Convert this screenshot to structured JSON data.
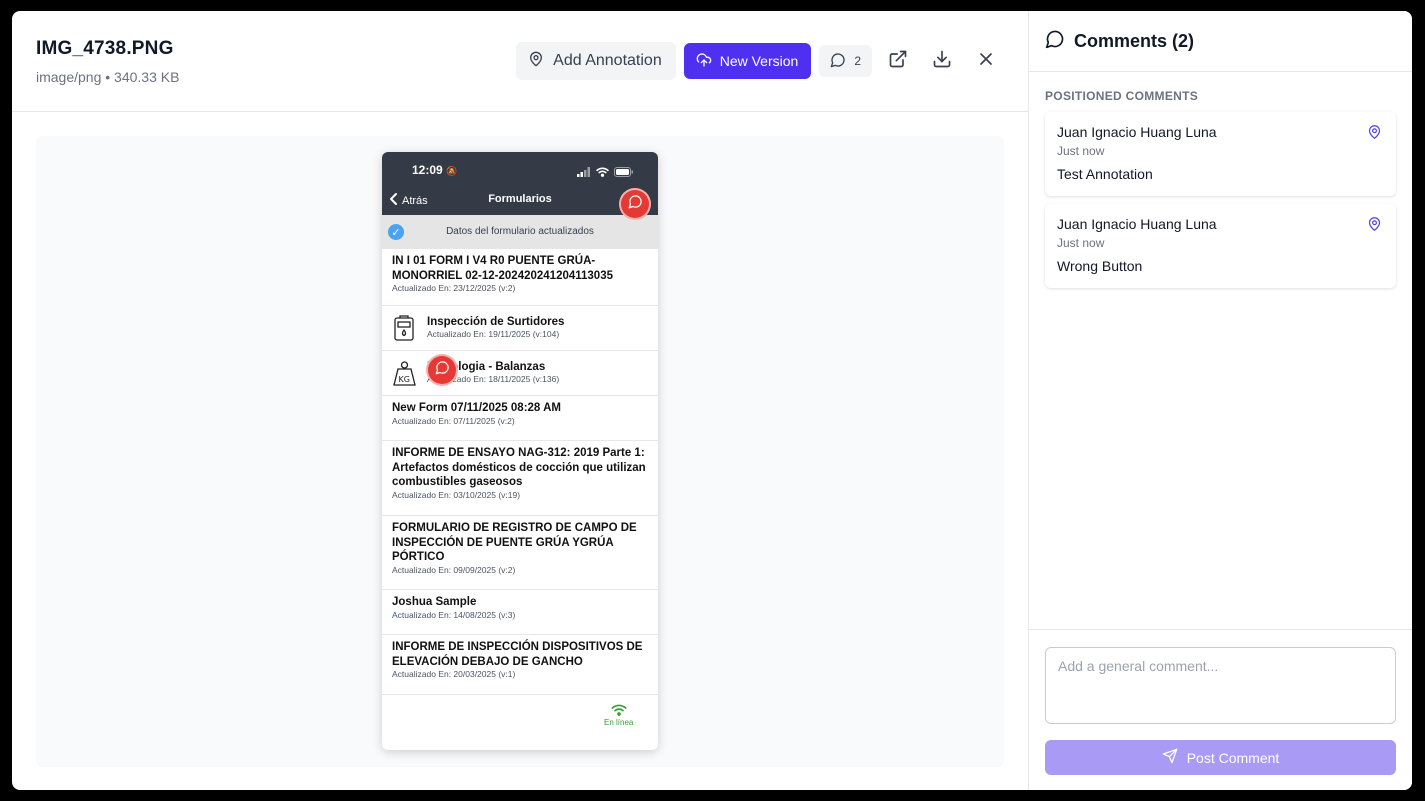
{
  "file": {
    "name": "IMG_4738.PNG",
    "meta": "image/png • 340.33 KB"
  },
  "toolbar": {
    "add_annotation_label": "Add Annotation",
    "new_version_label": "New Version",
    "comment_count": "2"
  },
  "phone": {
    "time": "12:09",
    "back_label": "Atrás",
    "title": "Formularios",
    "banner": "Datos del formulario actualizados",
    "items": [
      {
        "title": "IN I 01 FORM I V4 R0 PUENTE GRÚA-MONORRIEL 02-12-202420241204113035",
        "sub": "Actualizado En: 23/12/2025 (v:2)",
        "icon": ""
      },
      {
        "title": "Inspección de Surtidores",
        "sub": "Actualizado En: 19/11/2025 (v:104)",
        "icon": "fuel-pump-icon"
      },
      {
        "title": "Metrologia - Balanzas",
        "sub": "Actualizado En: 18/11/2025 (v:136)",
        "icon": "weight-kg-icon"
      },
      {
        "title": "New Form 07/11/2025 08:28 AM",
        "sub": "Actualizado En: 07/11/2025 (v:2)",
        "icon": ""
      },
      {
        "title": "INFORME DE ENSAYO NAG-312: 2019 Parte 1: Artefactos domésticos de cocción que utilizan combustibles gaseosos",
        "sub": "Actualizado En: 03/10/2025 (v:19)",
        "icon": ""
      },
      {
        "title": "FORMULARIO DE REGISTRO DE CAMPO DE INSPECCIÓN DE PUENTE GRÚA YGRÚA PÓRTICO",
        "sub": "Actualizado En: 09/09/2025 (v:2)",
        "icon": ""
      },
      {
        "title": "Joshua Sample",
        "sub": "Actualizado En: 14/08/2025 (v:3)",
        "icon": ""
      },
      {
        "title": "INFORME DE INSPECCIÓN DISPOSITIVOS DE ELEVACIÓN DEBAJO DE GANCHO",
        "sub": "Actualizado En: 20/03/2025 (v:1)",
        "icon": ""
      }
    ],
    "online_label": "En línea"
  },
  "comments_panel": {
    "title": "Comments (2)",
    "section_label": "POSITIONED COMMENTS",
    "comments": [
      {
        "author": "Juan Ignacio Huang Luna",
        "time": "Just now",
        "body": "Test Annotation"
      },
      {
        "author": "Juan Ignacio Huang Luna",
        "time": "Just now",
        "body": "Wrong Button"
      }
    ],
    "input_placeholder": "Add a general comment...",
    "post_label": "Post Comment"
  },
  "colors": {
    "primary": "#4f2ff0",
    "primary_disabled": "#a99af5",
    "annotation_pin": "#e53935",
    "pin_icon": "#4f46e5"
  }
}
